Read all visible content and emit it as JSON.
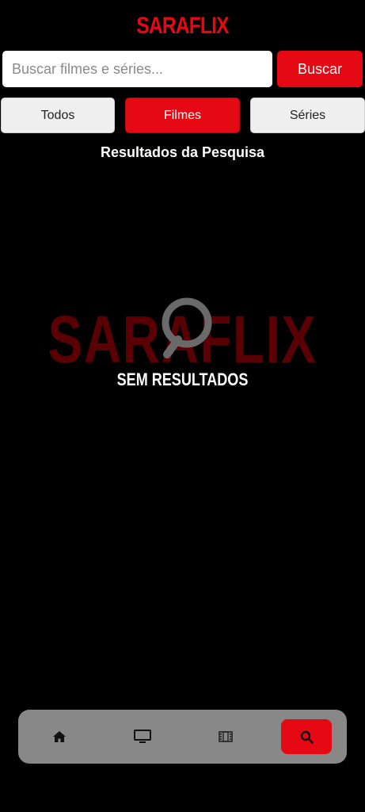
{
  "app": {
    "logo": "SARAFLIX"
  },
  "search": {
    "placeholder": "Buscar filmes e séries...",
    "value": "",
    "button_label": "Buscar"
  },
  "filters": {
    "tabs": [
      {
        "label": "Todos",
        "active": false
      },
      {
        "label": "Filmes",
        "active": true
      },
      {
        "label": "Séries",
        "active": false
      }
    ]
  },
  "results": {
    "title": "Resultados da Pesquisa",
    "empty_watermark": "SARAFLIX",
    "empty_text": "SEM RESULTADOS",
    "empty_icon": "search-icon"
  },
  "bottom_nav": {
    "items": [
      {
        "icon": "home-icon",
        "active": false
      },
      {
        "icon": "tv-icon",
        "active": false
      },
      {
        "icon": "film-icon",
        "active": false
      },
      {
        "icon": "search-icon",
        "active": true
      }
    ]
  },
  "colors": {
    "brand_red": "#e50914",
    "background": "#000000",
    "nav_background": "#888888",
    "watermark": "#5a0005"
  }
}
